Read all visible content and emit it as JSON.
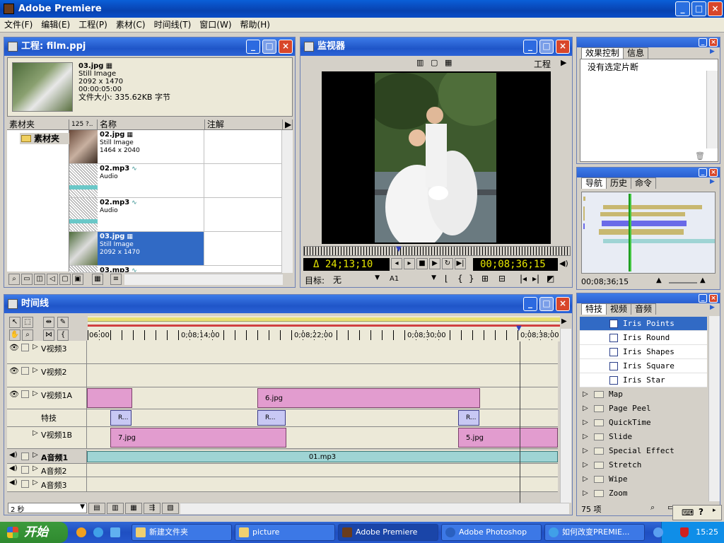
{
  "app": {
    "title": "Adobe Premiere"
  },
  "menu": [
    "文件(F)",
    "编辑(E)",
    "工程(P)",
    "素材(C)",
    "时间线(T)",
    "窗口(W)",
    "帮助(H)"
  ],
  "project": {
    "title": "工程: film.ppj",
    "preview": {
      "name": "03.jpg",
      "type": "Still Image",
      "dims": "2092 x 1470",
      "duration": "00:00:05:00",
      "size": "文件大小: 335.62KB 字节"
    },
    "bins_header": "素材夹",
    "bin_name": "素材夹",
    "count_header": "125 ?..",
    "name_header": "名称",
    "note_header": "注解",
    "clips": [
      {
        "name": "02.jpg",
        "type": "Still Image",
        "dims": "1464 x 2040"
      },
      {
        "name": "02.mp3",
        "type": "Audio",
        "dims": ""
      },
      {
        "name": "02.mp3",
        "type": "Audio",
        "dims": ""
      },
      {
        "name": "03.jpg",
        "type": "Still Image",
        "dims": "2092 x 1470"
      },
      {
        "name": "03.mp3",
        "type": "",
        "dims": ""
      }
    ]
  },
  "monitor": {
    "title": "监视器",
    "project_label": "工程",
    "duration_tc": "Δ 24;13;10",
    "current_tc": "00;08;36;15",
    "target_label": "目标:",
    "target_value": "无",
    "track_value": "A1"
  },
  "effect_controls": {
    "tabs": [
      "效果控制",
      "信息"
    ],
    "message": "没有选定片断"
  },
  "navigator": {
    "tabs": [
      "导航",
      "历史",
      "命令"
    ],
    "timecode": "00;08;36;15"
  },
  "effects": {
    "tabs": [
      "特技",
      "视频",
      "音频"
    ],
    "items": [
      {
        "label": "Iris Points",
        "sub": true,
        "selected": true
      },
      {
        "label": "Iris Round",
        "sub": true
      },
      {
        "label": "Iris Shapes",
        "sub": true
      },
      {
        "label": "Iris Square",
        "sub": true
      },
      {
        "label": "Iris Star",
        "sub": true
      },
      {
        "label": "Map",
        "sub": false
      },
      {
        "label": "Page Peel",
        "sub": false
      },
      {
        "label": "QuickTime",
        "sub": false
      },
      {
        "label": "Slide",
        "sub": false
      },
      {
        "label": "Special Effect",
        "sub": false
      },
      {
        "label": "Stretch",
        "sub": false
      },
      {
        "label": "Wipe",
        "sub": false
      },
      {
        "label": "Zoom",
        "sub": false
      }
    ],
    "count": "75 项"
  },
  "timeline": {
    "title": "时间线",
    "ruler": [
      "06:00",
      "0;08;14;00",
      "0;08;22;00",
      "0;08;30;00",
      "0;08;38;00"
    ],
    "tracks": {
      "v3": "V视频3",
      "v2": "V视频2",
      "v1a": "V视频1A",
      "fx": "特技",
      "v1b": "V视频1B",
      "a1": "A音频1",
      "a2": "A音频2",
      "a3": "A音频3"
    },
    "clips": {
      "v1a_clip": "6.jpg",
      "v1b_clip1": "7.jpg",
      "v1b_clip2": "5.jpg",
      "audio": "01.mp3",
      "trans": "R..."
    },
    "zoom": "2 秒"
  },
  "taskbar": {
    "start": "开始",
    "tasks": [
      "新建文件夹",
      "picture",
      "Adobe Premiere",
      "Adobe Photoshop",
      "如何改变PREMIE..."
    ],
    "clock": "15:25"
  }
}
